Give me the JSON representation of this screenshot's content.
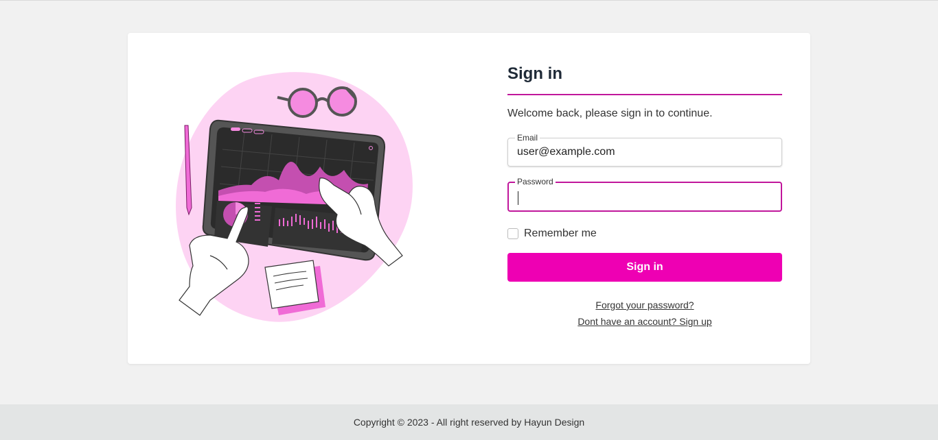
{
  "signin": {
    "title": "Sign in",
    "subtitle": "Welcome back, please sign in to continue.",
    "email_label": "Email",
    "email_value": "user@example.com",
    "password_label": "Password",
    "password_value": "",
    "remember_label": "Remember me",
    "remember_checked": false,
    "submit_label": "Sign in",
    "forgot_link": "Forgot your password?",
    "signup_link": "Dont have an account? Sign up"
  },
  "footer": {
    "text": "Copyright © 2023 - All right reserved by Hayun Design"
  },
  "colors": {
    "accent": "#ee00b3",
    "accent_dark": "#c0169b",
    "illustration_blob": "#fdd3f3",
    "page_bg": "#f1f1f1",
    "footer_bg": "#e3e5e5"
  }
}
